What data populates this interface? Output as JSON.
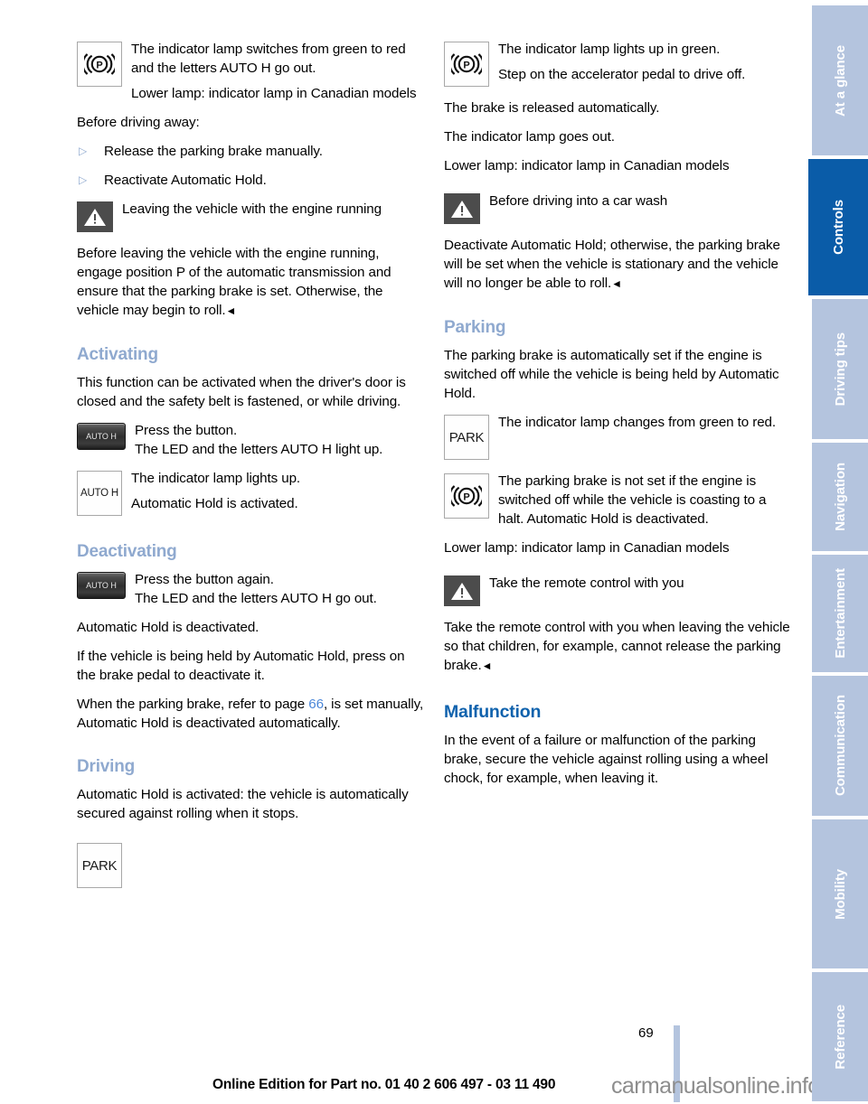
{
  "document": {
    "page_number": "69",
    "edition_line": "Online Edition for Part no. 01 40 2 606 497 - 03 11 490",
    "watermark": "carmanualsonline.info"
  },
  "colors": {
    "heading_main": "#0f62ad",
    "heading_sub": "#8fa9cf",
    "tab_inactive": "#b4c4de",
    "tab_active": "#0a5ca8",
    "page_ref_link": "#4a86d8"
  },
  "sidebar": {
    "tabs": [
      {
        "label": "At a glance",
        "active": false
      },
      {
        "label": "Controls",
        "active": true
      },
      {
        "label": "Driving tips",
        "active": false
      },
      {
        "label": "Navigation",
        "active": false
      },
      {
        "label": "Entertainment",
        "active": false
      },
      {
        "label": "Communication",
        "active": false
      },
      {
        "label": "Mobility",
        "active": false
      },
      {
        "label": "Reference",
        "active": false
      }
    ]
  },
  "left_column": {
    "block_brake_lamp": {
      "icon": "brake-p-symbol-icon",
      "line1": "The indicator lamp switches from green to red and the letters AUTO H go out.",
      "line2": "Lower lamp: indicator lamp in Canadian models"
    },
    "before_driving_away_label": "Before driving away:",
    "bullets": [
      "Release the parking brake manually.",
      "Reactivate Automatic Hold."
    ],
    "warning_engine_running": {
      "icon": "warning-triangle-icon",
      "title": "Leaving the vehicle with the engine running",
      "body": "Before leaving the vehicle with the engine running, engage position P of the automatic transmission and ensure that the parking brake is set. Otherwise, the vehicle may begin to roll.",
      "end_marker": "◄"
    },
    "activating": {
      "heading": "Activating",
      "intro": "This function can be activated when the driver's door is closed and the safety belt is fastened, or while driving.",
      "button_icon_label": "AUTO H",
      "press_line": "Press the button.",
      "led_line": "The LED and the letters AUTO H light up.",
      "lamp_icon_label": "AUTO H",
      "lamp_line1": "The indicator lamp lights up.",
      "lamp_line2": "Automatic Hold is activated."
    },
    "deactivating": {
      "heading": "Deactivating",
      "button_icon_label": "AUTO H",
      "press_line": "Press the button again.",
      "led_line": "The LED and the letters AUTO H go out.",
      "para1": "Automatic Hold is deactivated.",
      "para2": "If the vehicle is being held by Automatic Hold, press on the brake pedal to deactivate it.",
      "para3_before": "When the parking brake, refer to page ",
      "para3_page": "66",
      "para3_after": ", is set manually, Automatic Hold is deactivated automatically."
    },
    "driving": {
      "heading": "Driving",
      "para": "Automatic Hold is activated: the vehicle is automatically secured against rolling when it stops.",
      "park_icon_label": "PARK"
    }
  },
  "right_column": {
    "block_green_lamp": {
      "icon": "brake-p-symbol-icon",
      "line1": "The indicator lamp lights up in green.",
      "line2": "Step on the accelerator pedal to drive off."
    },
    "para_brake_released": "The brake is released automatically.",
    "para_lamp_out": "The indicator lamp goes out.",
    "para_lower_lamp": "Lower lamp: indicator lamp in Canadian models",
    "warning_car_wash": {
      "icon": "warning-triangle-icon",
      "title": "Before driving into a car wash",
      "body": "Deactivate Automatic Hold; otherwise, the parking brake will be set when the vehicle is stationary and the vehicle will no longer be able to roll.",
      "end_marker": "◄"
    },
    "parking": {
      "heading": "Parking",
      "intro": "The parking brake is automatically set if the engine is switched off while the vehicle is being held by Automatic Hold.",
      "park_icon_label": "PARK",
      "park_line": "The indicator lamp changes from green to red.",
      "brake_icon": "brake-p-symbol-icon",
      "brake_line": "The parking brake is not set if the engine is switched off while the vehicle is coasting to a halt. Automatic Hold is deactivated.",
      "lower_lamp": "Lower lamp: indicator lamp in Canadian models"
    },
    "warning_remote": {
      "icon": "warning-triangle-icon",
      "title": "Take the remote control with you",
      "body": "Take the remote control with you when leaving the vehicle so that children, for example, cannot release the parking brake.",
      "end_marker": "◄"
    },
    "malfunction": {
      "heading": "Malfunction",
      "para": "In the event of a failure or malfunction of the parking brake, secure the vehicle against rolling using a wheel chock, for example, when leaving it."
    }
  }
}
